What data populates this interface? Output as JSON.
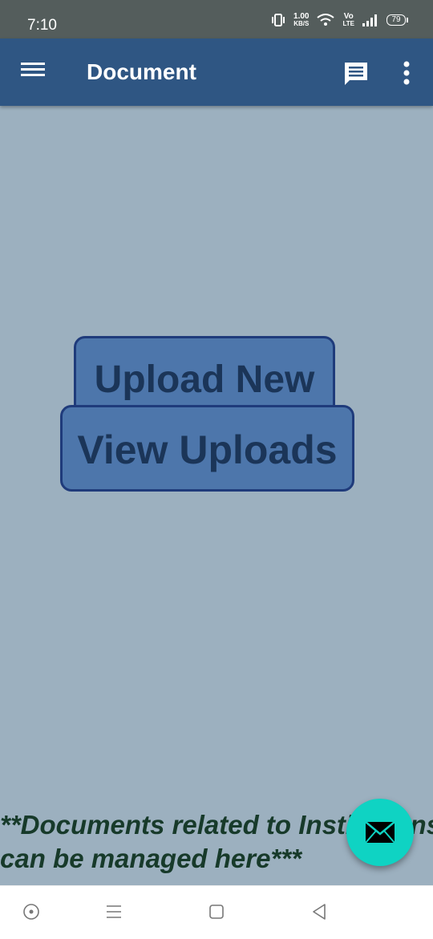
{
  "status_bar": {
    "time": "7:10",
    "net_speed_value": "1.00",
    "net_speed_unit": "KB/S",
    "volte_top": "Vo",
    "volte_bottom": "LTE",
    "battery": "79"
  },
  "app_bar": {
    "title": "Document",
    "icons": [
      "menu-icon",
      "chat-icon",
      "more-vert-icon"
    ],
    "color": "#2f5683"
  },
  "main": {
    "upload_button_label": "Upload New",
    "view_button_label": "View Uploads",
    "note_line1": "**Documents related to Institutions",
    "note_line2": "can be managed here***",
    "background": "#9cb0bf"
  },
  "fab": {
    "icon": "mail-icon",
    "color": "#0fd3c3"
  },
  "nav_bar": {
    "icons": [
      "assistant-dot-icon",
      "recents-icon",
      "home-icon",
      "back-icon"
    ]
  }
}
